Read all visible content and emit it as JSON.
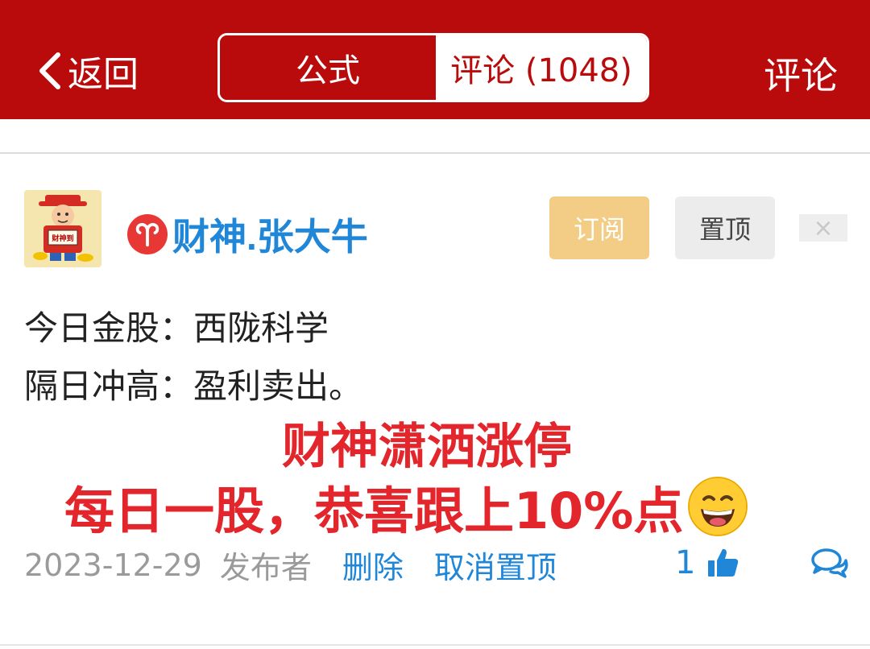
{
  "header": {
    "back_label": "返回",
    "tabs": [
      {
        "label": "公式",
        "active": false
      },
      {
        "label": "评论 (1048)",
        "active": true
      }
    ],
    "comment_label": "评论",
    "bg_color": "#b90b0b"
  },
  "post": {
    "username": "财神.张大牛",
    "zodiac_icon": "aries-icon",
    "avatar_text": "财神到",
    "subscribe_label": "订阅",
    "pin_label": "置顶",
    "close_label": "×",
    "lines": [
      "今日金股：西陇科学",
      "隔日冲高：盈利卖出。"
    ],
    "promo_line1": "财神潇洒涨停",
    "promo_line2": "每日一股，恭喜跟上10%点",
    "date": "2023-12-29",
    "publisher_label": "发布者",
    "delete_label": "删除",
    "unpin_label": "取消置顶",
    "like_count": "1",
    "accent_color": "#1f86d8",
    "promo_color": "#e3252c"
  }
}
